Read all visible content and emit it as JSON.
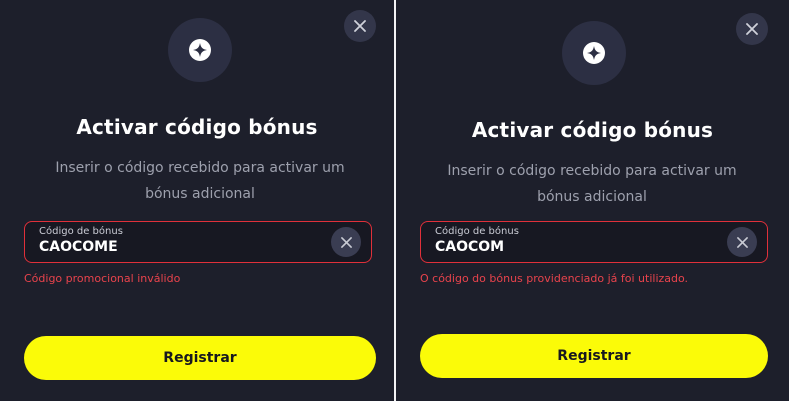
{
  "colors": {
    "background": "#1d1f2b",
    "accent_yellow": "#fbfb08",
    "error_red": "#e0303a"
  },
  "panels": [
    {
      "title": "Activar código bónus",
      "subtitle": "Inserir o código recebido para activar um bónus adicional",
      "field": {
        "label": "Código de bónus",
        "value": "CAOCOME"
      },
      "error": "Código promocional inválido",
      "submit_label": "Registrar"
    },
    {
      "title": "Activar código bónus",
      "subtitle": "Inserir o código recebido para activar um bónus adicional",
      "field": {
        "label": "Código de bónus",
        "value": "CAOCOM"
      },
      "error": "O código do bónus providenciado já foi utilizado.",
      "submit_label": "Registrar"
    }
  ],
  "icons": {
    "close": "close-icon",
    "badge": "sparkle-icon",
    "clear": "clear-icon"
  }
}
